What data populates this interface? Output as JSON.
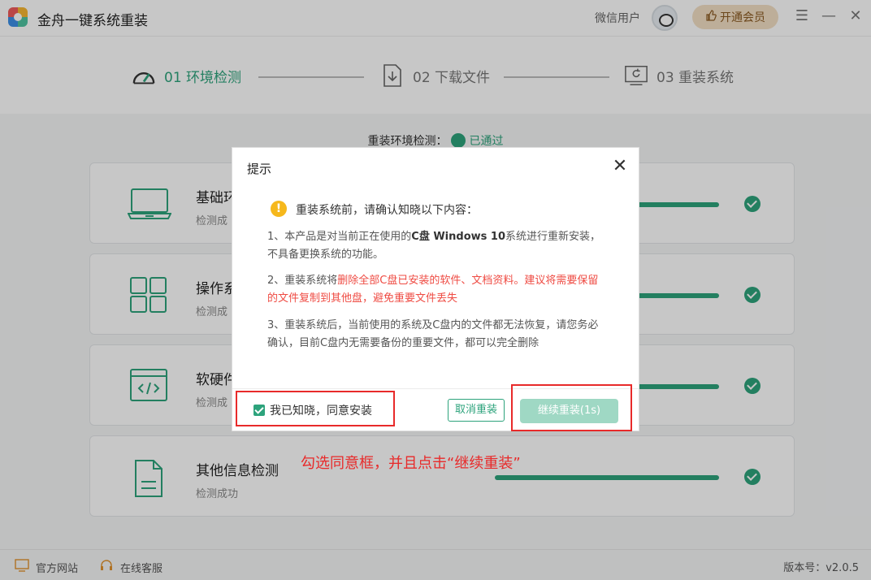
{
  "window": {
    "title": "金舟一键系统重装",
    "user_name": "微信用户",
    "vip_label": "开通会员",
    "menu_glyph": "☰",
    "minimize_glyph": "—",
    "close_glyph": "✕"
  },
  "steps": [
    {
      "label": "01 环境检测",
      "icon": "gauge-icon",
      "active": true
    },
    {
      "label": "02 下载文件",
      "icon": "download-icon",
      "active": false
    },
    {
      "label": "03 重装系统",
      "icon": "refresh-monitor-icon",
      "active": false
    }
  ],
  "check_header": {
    "label": "重装环境检测：",
    "status": "已通过"
  },
  "checks": [
    {
      "title": "基础环",
      "subtitle": "检测成",
      "icon": "laptop-icon",
      "progress": 1.0
    },
    {
      "title": "操作系",
      "subtitle": "检测成",
      "icon": "grid-icon",
      "progress": 1.0
    },
    {
      "title": "软硬件",
      "subtitle": "检测成",
      "icon": "code-window-icon",
      "progress": 1.0
    },
    {
      "title": "其他信息检测",
      "subtitle": "检测成功",
      "icon": "document-icon",
      "progress": 1.0
    }
  ],
  "dialog": {
    "title": "提示",
    "close_glyph": "✕",
    "warning": "重装系统前，请确认知晓以下内容：",
    "para1_a": "1、本产品是对当前正在使用的",
    "para1_b": "C盘 Windows 10",
    "para1_c": "系统进行重新安装，不具备更换系统的功能。",
    "para2_a": "2、重装系统将",
    "para2_b": "删除全部C盘已安装的软件、文档资料。建议将需要保留的文件复制到其他盘，避免重要文件丢失",
    "para3": "3、重装系统后，当前使用的系统及C盘内的文件都无法恢复，请您务必确认，目前C盘内无需要备份的重要文件，都可以完全删除",
    "agree_label": "我已知晓，同意安装",
    "agree_checked": true,
    "cancel_label": "取消重装",
    "continue_label": "继续重装(1s)"
  },
  "annotation": {
    "text": "勾选同意框，并且点击“继续重装”",
    "color": "#e82a2a"
  },
  "footer": {
    "website": "官方网站",
    "support": "在线客服",
    "version": "版本号：v2.0.5"
  },
  "colors": {
    "accent": "#2da37c",
    "warning": "#f6b81c",
    "danger": "#ef4b43"
  }
}
